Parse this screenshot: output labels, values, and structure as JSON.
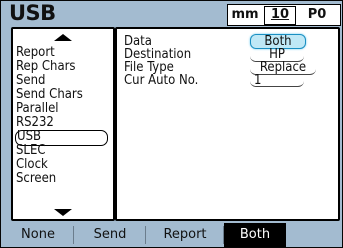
{
  "header": {
    "title": "USB",
    "units": {
      "mm": "mm",
      "resolution": "10",
      "preset": "P0"
    }
  },
  "menu": {
    "items": [
      {
        "label": "Report",
        "selected": false
      },
      {
        "label": "Rep Chars",
        "selected": false
      },
      {
        "label": "Send",
        "selected": false
      },
      {
        "label": "Send Chars",
        "selected": false
      },
      {
        "label": "Parallel",
        "selected": false
      },
      {
        "label": "RS232",
        "selected": false
      },
      {
        "label": "USB",
        "selected": true
      },
      {
        "label": "SLEC",
        "selected": false
      },
      {
        "label": "Clock",
        "selected": false
      },
      {
        "label": "Screen",
        "selected": false
      }
    ]
  },
  "settings": {
    "rows": [
      {
        "label": "Data",
        "value": "Both",
        "active": true
      },
      {
        "label": "Destination",
        "value": "HP",
        "active": false
      },
      {
        "label": "File Type",
        "value": "Replace",
        "active": false
      },
      {
        "label": "Cur Auto No.",
        "value": "1",
        "active": false
      }
    ]
  },
  "softkeys": [
    {
      "label": "None",
      "active": false
    },
    {
      "label": "Send",
      "active": false
    },
    {
      "label": "Report",
      "active": false
    },
    {
      "label": "Both",
      "active": true
    }
  ],
  "colors": {
    "background": "#a3bbd0",
    "active_field": "#bfe8f6",
    "active_field_border": "#1a8fc2",
    "active_softkey": "#000000"
  }
}
